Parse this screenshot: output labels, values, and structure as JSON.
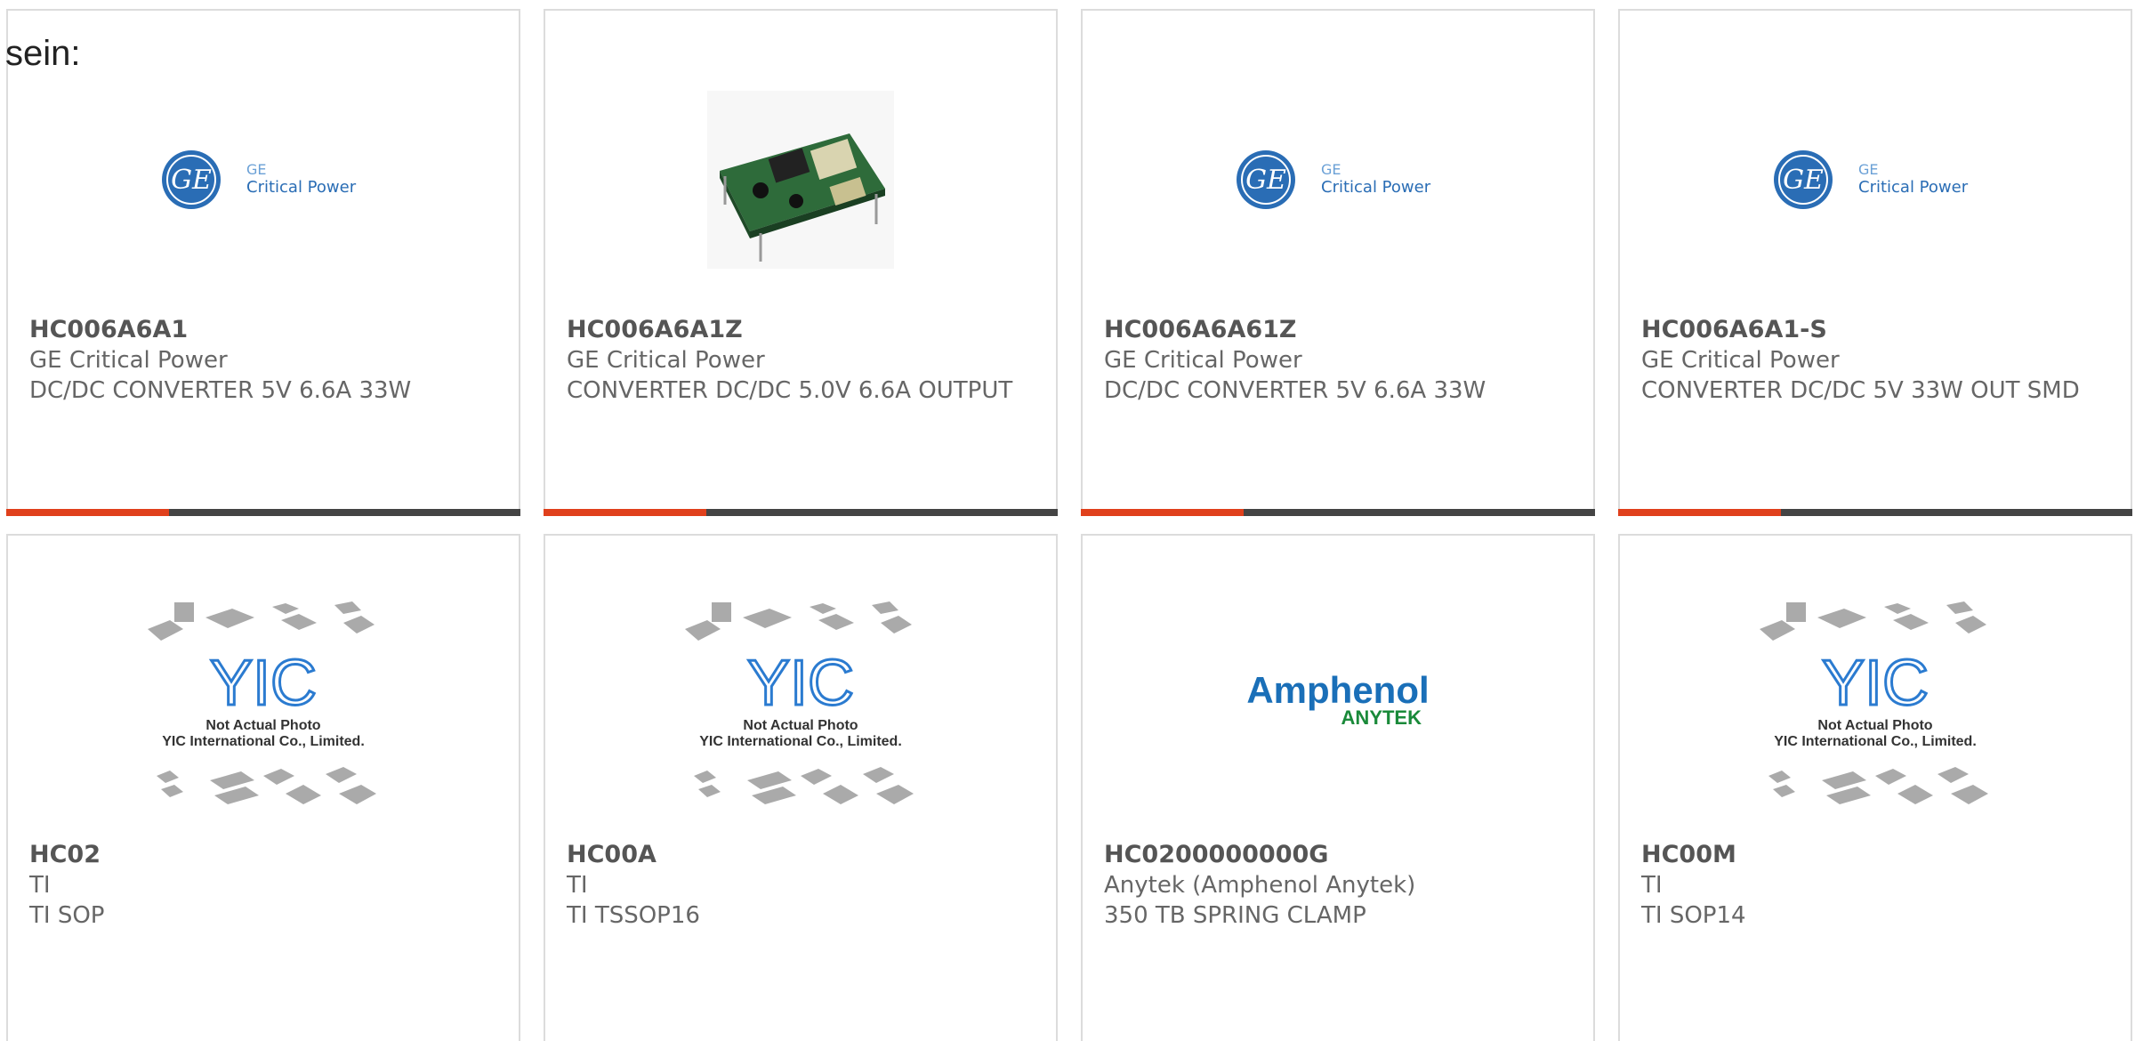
{
  "prefix_text": "sein:",
  "cards": [
    {
      "part": "HC006A6A1",
      "mfr": "GE Critical Power",
      "desc": "DC/DC CONVERTER 5V 6.6A 33W",
      "image": "ge-logo",
      "logo_line1": "GE",
      "logo_line2": "Critical Power"
    },
    {
      "part": "HC006A6A1Z",
      "mfr": "GE Critical Power",
      "desc": "CONVERTER DC/DC 5.0V 6.6A OUTPUT",
      "image": "pcb-module-photo"
    },
    {
      "part": "HC006A6A61Z",
      "mfr": "GE Critical Power",
      "desc": "DC/DC CONVERTER 5V 6.6A 33W",
      "image": "ge-logo",
      "logo_line1": "GE",
      "logo_line2": "Critical Power"
    },
    {
      "part": "HC006A6A1-S",
      "mfr": "GE Critical Power",
      "desc": "CONVERTER DC/DC 5V 33W OUT SMD",
      "image": "ge-logo",
      "logo_line1": "GE",
      "logo_line2": "Critical Power"
    },
    {
      "part": "HC02",
      "mfr": "TI",
      "desc": "TI SOP",
      "image": "yic-placeholder",
      "ph_line1": "Not Actual Photo",
      "ph_line2": "YIC International Co., Limited."
    },
    {
      "part": "HC00A",
      "mfr": "TI",
      "desc": "TI TSSOP16",
      "image": "yic-placeholder",
      "ph_line1": "Not Actual Photo",
      "ph_line2": "YIC International Co., Limited."
    },
    {
      "part": "HC0200000000G",
      "mfr": "Anytek (Amphenol Anytek)",
      "desc": "350 TB SPRING CLAMP",
      "image": "amphenol-logo",
      "logo_line1": "Amphenol",
      "logo_line2": "ANYTEK"
    },
    {
      "part": "HC00M",
      "mfr": "TI",
      "desc": "TI SOP14",
      "image": "yic-placeholder",
      "ph_line1": "Not Actual Photo",
      "ph_line2": "YIC International Co., Limited."
    }
  ],
  "colors": {
    "accent": "#e0401c",
    "stripe_dark": "#444444",
    "ge_blue": "#2a6db5",
    "amphenol_blue": "#1a6fb8",
    "anytek_green": "#1a8a3a",
    "yic_blue": "#2b7bd0"
  }
}
